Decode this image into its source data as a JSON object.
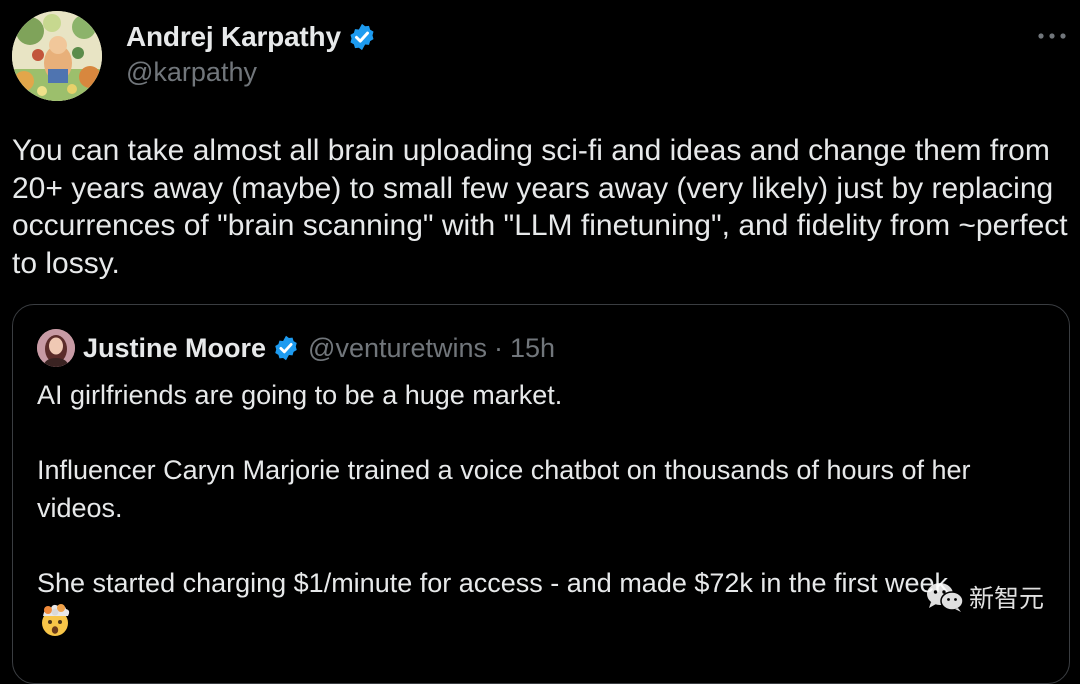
{
  "author": {
    "display_name": "Andrej Karpathy",
    "handle": "@karpathy",
    "verified": true,
    "avatar_icon": "avatar-illustration-icon"
  },
  "tweet": {
    "text": "You can take almost all brain uploading sci-fi and ideas and change them from 20+ years away (maybe) to small few years away (very likely) just by replacing occurrences of \"brain scanning\" with \"LLM finetuning\", and fidelity from ~perfect to lossy."
  },
  "menu": {
    "icon": "more-horizontal-icon"
  },
  "quoted_tweet": {
    "display_name": "Justine Moore",
    "handle": "@venturetwins",
    "separator": "·",
    "time": "15h",
    "verified": true,
    "paragraphs": [
      "AI girlfriends are going to be a huge market.",
      "Influencer Caryn Marjorie trained a voice chatbot on thousands of hours of her videos.",
      "She started charging $1/minute for access - and made $72k in the first week"
    ],
    "trailing_emoji": "exploding-head-emoji"
  },
  "watermark": {
    "text": "新智元",
    "icon": "wechat-logo-icon"
  },
  "colors": {
    "background": "#000000",
    "text_primary": "#e7e9ea",
    "text_secondary": "#71767b",
    "verified_blue": "#1d9bf0",
    "card_border": "#3a3d41"
  }
}
